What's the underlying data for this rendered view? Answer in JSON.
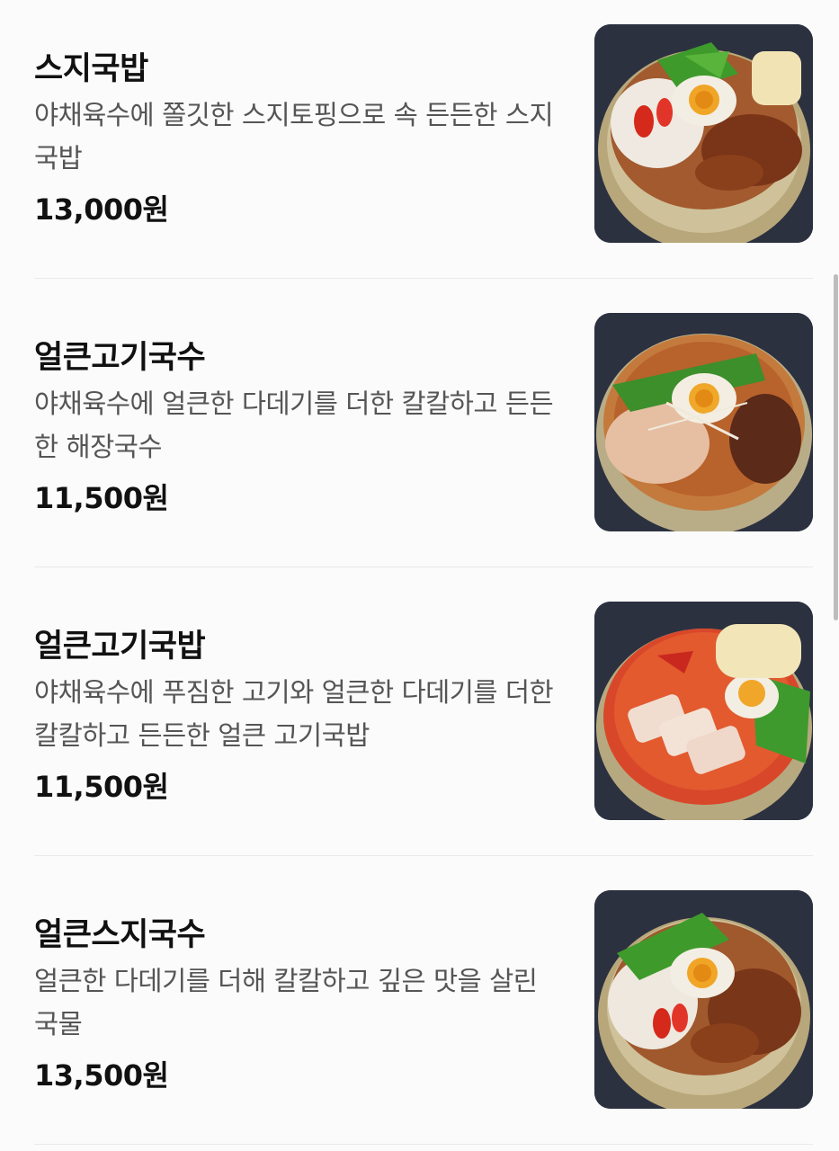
{
  "menu": {
    "items": [
      {
        "name": "스지국밥",
        "description": "야채육수에 쫄깃한 스지토핑으로 속 든든한 스지국밥",
        "price": "13,000원",
        "image": "bowl-photo"
      },
      {
        "name": "얼큰고기국수",
        "description": "야채육수에 얼큰한 다데기를 더한 칼칼하고 든든한 해장국수",
        "price": "11,500원",
        "image": "bowl-photo"
      },
      {
        "name": "얼큰고기국밥",
        "description": "야채육수에 푸짐한 고기와 얼큰한 다데기를 더한 칼칼하고 든든한 얼큰 고기국밥",
        "price": "11,500원",
        "image": "bowl-photo"
      },
      {
        "name": "얼큰스지국수",
        "description": "얼큰한 다데기를 더해 칼칼하고 깊은 맛을 살린 국물",
        "price": "13,500원",
        "image": "bowl-photo"
      }
    ]
  },
  "colors": {
    "background": "#fbfbfb",
    "title": "#111111",
    "description": "#555555",
    "divider": "#e9e9e9"
  }
}
